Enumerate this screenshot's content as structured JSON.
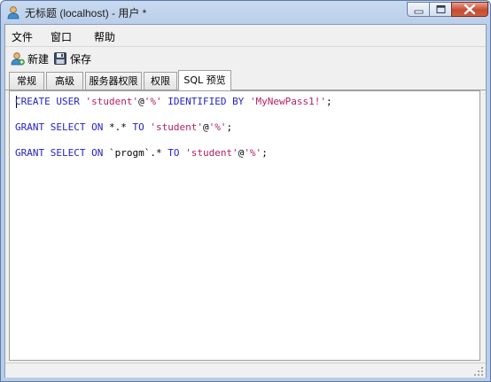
{
  "window": {
    "title": "无标题 (localhost) - 用户 *"
  },
  "menu": {
    "items": [
      {
        "label": "文件"
      },
      {
        "label": "窗口"
      },
      {
        "label": "帮助"
      }
    ]
  },
  "toolbar": {
    "new_label": "新建",
    "save_label": "保存"
  },
  "tabs": [
    {
      "label": "常规"
    },
    {
      "label": "高级"
    },
    {
      "label": "服务器权限"
    },
    {
      "label": "权限"
    },
    {
      "label": "SQL 预览"
    }
  ],
  "active_tab": "SQL 预览",
  "sql_preview": {
    "lines": [
      [
        {
          "t": "CREATE USER ",
          "k": "kw"
        },
        {
          "t": "'student'",
          "k": "str"
        },
        {
          "t": "@",
          "k": "op"
        },
        {
          "t": "'%'",
          "k": "str"
        },
        {
          "t": " IDENTIFIED BY ",
          "k": "kw"
        },
        {
          "t": "'MyNewPass1!'",
          "k": "str"
        },
        {
          "t": ";",
          "k": "op"
        }
      ],
      [
        {
          "t": "GRANT SELECT ON ",
          "k": "kw"
        },
        {
          "t": "*.* ",
          "k": "op"
        },
        {
          "t": "TO ",
          "k": "kw"
        },
        {
          "t": "'student'",
          "k": "str"
        },
        {
          "t": "@",
          "k": "op"
        },
        {
          "t": "'%'",
          "k": "str"
        },
        {
          "t": ";",
          "k": "op"
        }
      ],
      [
        {
          "t": "GRANT SELECT ON ",
          "k": "kw"
        },
        {
          "t": "`progm`.* ",
          "k": "op"
        },
        {
          "t": "TO ",
          "k": "kw"
        },
        {
          "t": "'student'",
          "k": "str"
        },
        {
          "t": "@",
          "k": "op"
        },
        {
          "t": "'%'",
          "k": "str"
        },
        {
          "t": ";",
          "k": "op"
        }
      ]
    ]
  },
  "colors": {
    "keyword": "#2323c8",
    "string": "#b41e64",
    "operator": "#000000",
    "accent": "#b8cde9"
  },
  "icons": {
    "app": "user-icon",
    "new": "user-add-icon",
    "save": "floppy-disk-icon",
    "minimize": "minimize-icon",
    "maximize": "maximize-icon",
    "close": "close-icon"
  }
}
